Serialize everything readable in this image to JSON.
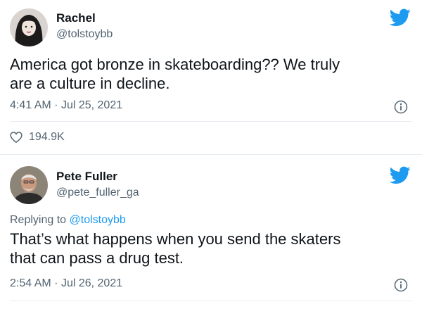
{
  "tweets": [
    {
      "author": {
        "name": "Rachel",
        "handle": "@tolstoybb"
      },
      "text_lines": [
        "America got bronze in skateboarding?? We truly",
        "are a culture in decline."
      ],
      "time": "4:41 AM",
      "separator": "·",
      "date": "Jul 25, 2021",
      "likes": "194.9K",
      "icons": {
        "platform": "twitter-bird-icon",
        "info": "info-icon",
        "like": "heart-icon"
      }
    },
    {
      "author": {
        "name": "Pete Fuller",
        "handle": "@pete_fuller_ga"
      },
      "replying_prefix": "Replying to",
      "replying_to": "@tolstoybb",
      "text_lines": [
        "That’s what happens when you send the skaters",
        "that can pass a drug test."
      ],
      "time": "2:54 AM",
      "separator": "·",
      "date": "Jul 26, 2021",
      "icons": {
        "platform": "twitter-bird-icon",
        "info": "info-icon"
      }
    }
  ],
  "colors": {
    "accent": "#1d9bf0",
    "secondary_text": "#536471",
    "divider": "#e7ecf0"
  }
}
